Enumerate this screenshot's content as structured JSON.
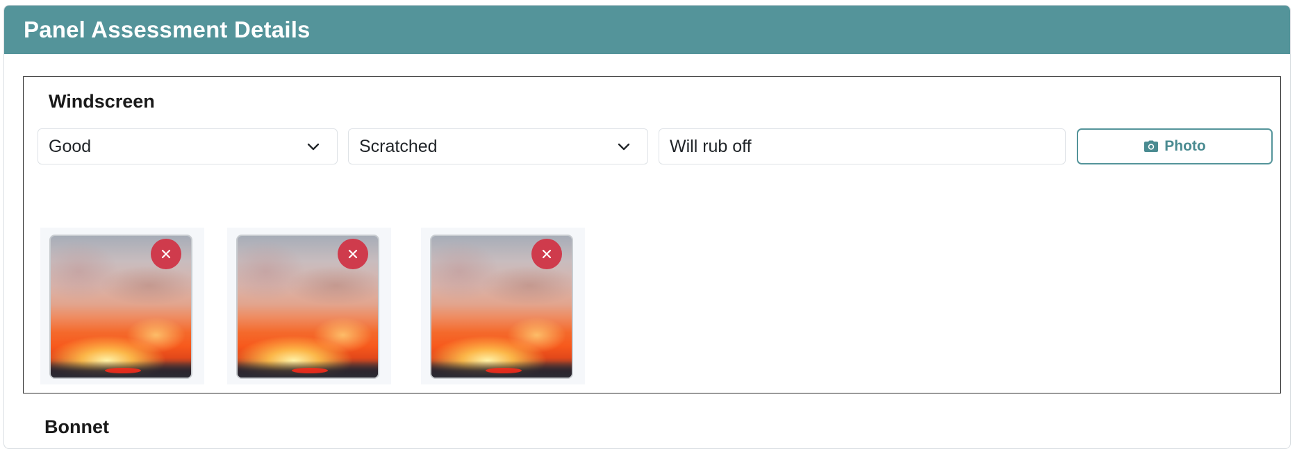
{
  "header": {
    "title": "Panel Assessment Details"
  },
  "panels": [
    {
      "name": "Windscreen",
      "condition": "Good",
      "damage": "Scratched",
      "note": "Will rub off",
      "photo_button_label": "Photo",
      "photos": [
        {
          "icon": "remove-icon"
        },
        {
          "icon": "remove-icon"
        },
        {
          "icon": "remove-icon"
        }
      ]
    },
    {
      "name": "Bonnet"
    }
  ],
  "colors": {
    "header_bg": "#54949a",
    "accent": "#54949a",
    "remove": "#cf3b4c"
  }
}
